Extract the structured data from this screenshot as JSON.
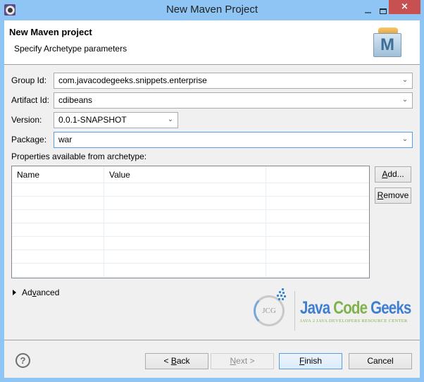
{
  "window": {
    "title": "New Maven Project",
    "app_icon": "eclipse-gear-icon",
    "controls": {
      "minimize": "minimize-icon",
      "maximize": "maximize-icon",
      "close": "×"
    }
  },
  "banner": {
    "title": "New Maven project",
    "subtitle": "Specify Archetype parameters",
    "icon": "maven-icon",
    "icon_letter": "M"
  },
  "form": {
    "group_id": {
      "label": "Group Id:",
      "value": "com.javacodegeeks.snippets.enterprise"
    },
    "artifact_id": {
      "label": "Artifact Id:",
      "value": "cdibeans"
    },
    "version": {
      "label": "Version:",
      "value": "0.0.1-SNAPSHOT"
    },
    "package": {
      "label": "Package:",
      "value": "war"
    }
  },
  "properties": {
    "label": "Properties available from archetype:",
    "columns": [
      "Name",
      "Value",
      ""
    ],
    "rows": [],
    "empty_row_count": 7,
    "add_button": {
      "prefix": "",
      "mnemonic": "A",
      "rest": "dd..."
    },
    "remove_button": {
      "prefix": "",
      "mnemonic": "R",
      "rest": "emove"
    }
  },
  "advanced": {
    "prefix": "Ad",
    "mnemonic": "v",
    "rest": "anced",
    "expanded": false
  },
  "logo": {
    "circle_text": "JCG",
    "word1": "Java",
    "word2": "Code",
    "word3": "Geeks",
    "tagline": "JAVA 2 JAVA DEVELOPERS RESOURCE CENTER"
  },
  "footer": {
    "help_icon": "?",
    "back": {
      "prefix": "< ",
      "mnemonic": "B",
      "rest": "ack",
      "enabled": true
    },
    "next": {
      "prefix": "",
      "mnemonic": "N",
      "rest": "ext >",
      "enabled": false
    },
    "finish": {
      "prefix": "",
      "mnemonic": "F",
      "rest": "inish",
      "enabled": true,
      "default": true
    },
    "cancel": {
      "label": "Cancel",
      "enabled": true
    }
  },
  "colors": {
    "window_frame": "#8ec5f5",
    "close_button": "#c75050",
    "focus_border": "#569de5",
    "logo_blue": "#3f7ed1",
    "logo_green": "#7fb24a"
  }
}
